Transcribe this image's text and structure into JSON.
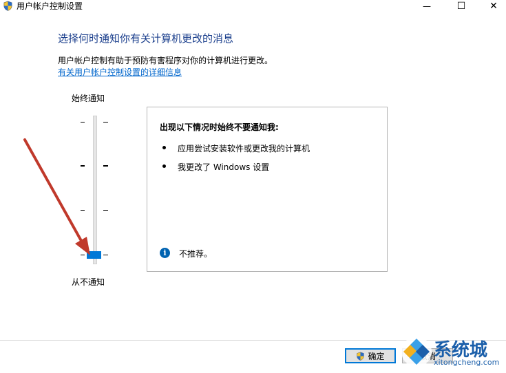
{
  "window": {
    "title": "用户帐户控制设置",
    "minimize": "—",
    "maximize": "☐",
    "close": "✕"
  },
  "heading": "选择何时通知你有关计算机更改的消息",
  "description": "用户帐户控制有助于预防有害程序对你的计算机进行更改。",
  "link_text": "有关用户帐户控制设置的详细信息",
  "slider": {
    "top_label": "始终通知",
    "bottom_label": "从不通知",
    "level": 0,
    "levels": 4
  },
  "panel": {
    "title": "出现以下情况时始终不要通知我:",
    "items": [
      "应用尝试安装软件或更改我的计算机",
      "我更改了 Windows 设置"
    ],
    "info_text": "不推荐。"
  },
  "buttons": {
    "ok": "确定",
    "cancel": "取消"
  },
  "watermark": {
    "brand": "系统城",
    "url": "xitongcheng.com"
  },
  "colors": {
    "heading": "#1a3e8c",
    "link": "#0066cc",
    "accent": "#0078d7",
    "annotation_arrow": "#c0392b"
  }
}
